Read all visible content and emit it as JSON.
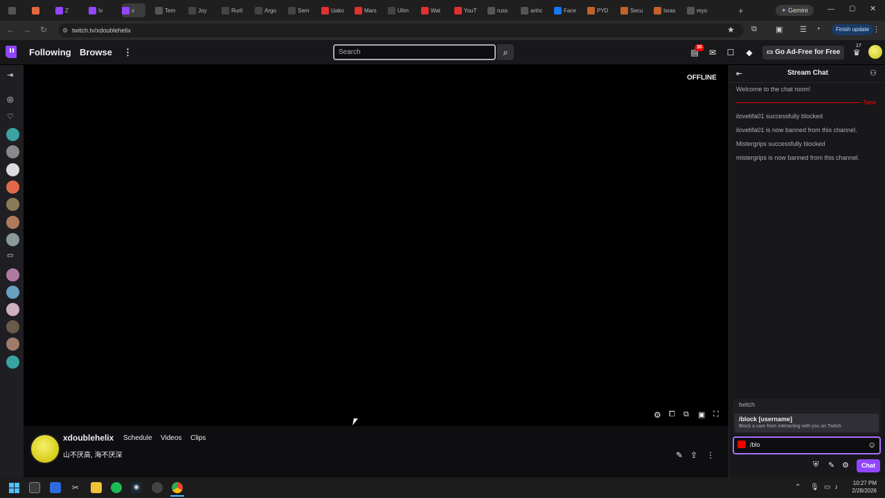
{
  "browser": {
    "tabs": [
      {
        "label": "",
        "color": "#555555"
      },
      {
        "label": "",
        "color": "#e06a3c"
      },
      {
        "label": "Z",
        "color": "#9146ff"
      },
      {
        "label": "Iv",
        "color": "#9146ff"
      },
      {
        "label": "x",
        "color": "#9146ff"
      },
      {
        "label": "Tem",
        "color": "#555555"
      },
      {
        "label": "Joy",
        "color": "#444444"
      },
      {
        "label": "Rurli",
        "color": "#444444"
      },
      {
        "label": "Argo",
        "color": "#444444"
      },
      {
        "label": "Sem",
        "color": "#444444"
      },
      {
        "label": "Uako",
        "color": "#e03030"
      },
      {
        "label": "Mars",
        "color": "#e03030"
      },
      {
        "label": "Ulim",
        "color": "#444444"
      },
      {
        "label": "Wat",
        "color": "#e03030"
      },
      {
        "label": "YouT",
        "color": "#e03030"
      },
      {
        "label": "russ",
        "color": "#555555"
      },
      {
        "label": "anhc",
        "color": "#555555"
      },
      {
        "label": "Face",
        "color": "#1877f2"
      },
      {
        "label": "PYD",
        "color": "#c0622a"
      },
      {
        "label": "Secu",
        "color": "#c0622a"
      },
      {
        "label": "Isras",
        "color": "#c0622a"
      },
      {
        "label": "myo",
        "color": "#555555"
      }
    ],
    "new_tab": "+",
    "gemini_label": "Gemini",
    "url": "twitch.tv/xdoublehelix",
    "finish_update": "Finish update"
  },
  "twitch": {
    "following": "Following",
    "browse": "Browse",
    "more": "⋮",
    "search_placeholder": "Search",
    "notifications_count": "30",
    "ad_free": "Go Ad-Free for Free",
    "bits_count": "17"
  },
  "player": {
    "status": "OFFLINE"
  },
  "channel": {
    "name": "xdoublehelix",
    "tabs": [
      "Schedule",
      "Videos",
      "Clips"
    ],
    "description": "山不厌高, 海不厌深"
  },
  "chat": {
    "title": "Stream Chat",
    "welcome": "Welcome to the chat room!",
    "new_label": "New",
    "messages": [
      "ilovetifa01 successfully blocked",
      "ilovetifa01 is now banned from this channel.",
      "Mistergrips successfully blocked",
      "mistergrips is now banned from this channel."
    ],
    "suggestion_group": "twitch",
    "suggestion_command": "/block [username]",
    "suggestion_desc": "Block a user from interacting with you on Twitch",
    "input_value": "/blo",
    "send_label": "Chat"
  },
  "taskbar": {
    "time": "10:27 PM",
    "date": "2/28/2026"
  }
}
